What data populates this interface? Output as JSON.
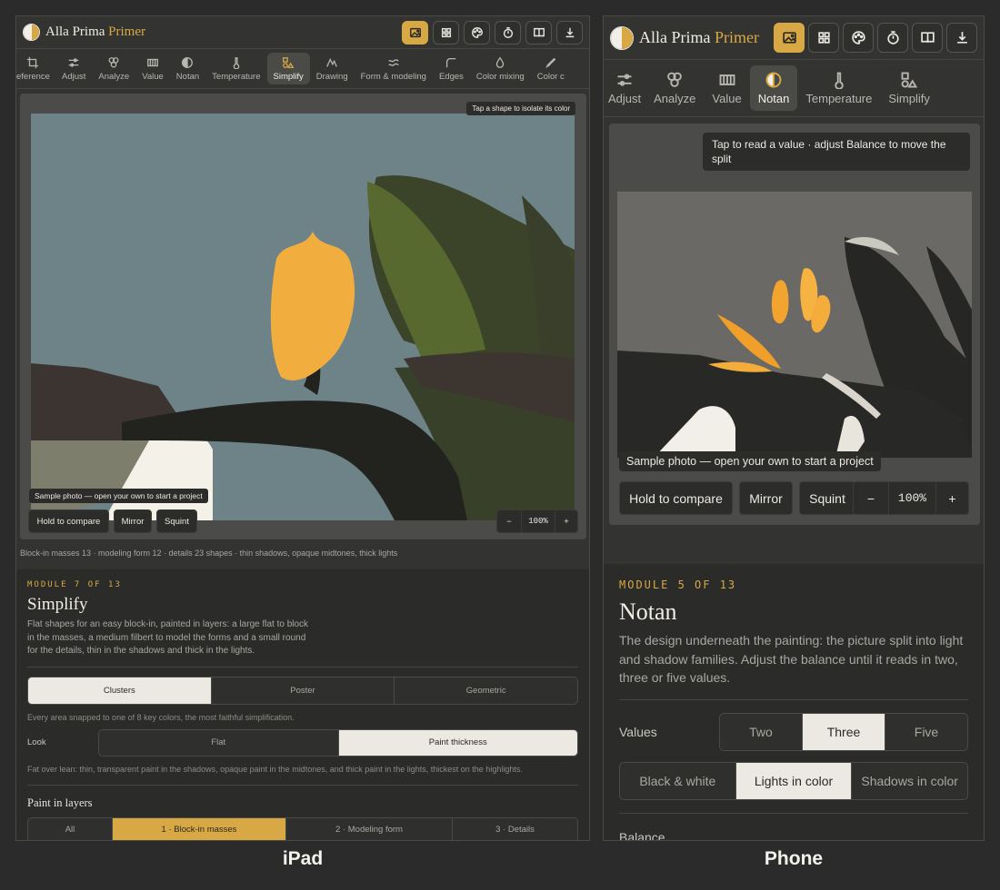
{
  "ipad": {
    "caption": "iPad",
    "brand": "Alla Prima",
    "brand_accent": "Primer",
    "tabs": [
      "eference",
      "Adjust",
      "Analyze",
      "Value",
      "Notan",
      "Temperature",
      "Simplify",
      "Drawing",
      "Form & modeling",
      "Edges",
      "Color mixing",
      "Color c"
    ],
    "active_tab": "Simplify",
    "hint": "Tap a shape to isolate its color",
    "sample": "Sample photo — open your own to start a project",
    "hold": "Hold to compare",
    "mirror": "Mirror",
    "squint": "Squint",
    "zoom_minus": "−",
    "zoom_value": "100%",
    "zoom_plus": "+",
    "stats": "Block-in masses 13 · modeling form 12 · details 23 shapes · thin shadows, opaque midtones, thick lights",
    "module": "MODULE 7 OF 13",
    "title": "Simplify",
    "desc_lines": [
      "Flat shapes for an easy block-in, painted in layers: a large flat to block",
      "in the masses, a medium filbert to model the forms and a small round",
      "for the details, thin in the shadows and thick in the lights."
    ],
    "mode_options": [
      "Clusters",
      "Poster",
      "Geometric"
    ],
    "mode_selected": "Clusters",
    "mode_note": "Every area snapped to one of 8 key colors, the most faithful simplification.",
    "look_label": "Look",
    "look_options": [
      "Flat",
      "Paint thickness"
    ],
    "look_selected": "Paint thickness",
    "look_note": "Fat over lean: thin, transparent paint in the shadows, opaque paint in the midtones, and thick paint in the lights, thickest on the highlights.",
    "layers_title": "Paint in layers",
    "layer_options": [
      "All",
      "1 · Block-in masses",
      "2 · Modeling form",
      "3 · Details"
    ],
    "layer_selected": "1 · Block-in masses"
  },
  "phone": {
    "caption": "Phone",
    "brand": "Alla Prima",
    "brand_accent": "Primer",
    "tabs": [
      "Adjust",
      "Analyze",
      "Value",
      "Notan",
      "Temperature",
      "Simplify"
    ],
    "active_tab": "Notan",
    "hint": "Tap to read a value · adjust Balance to move the split",
    "sample": "Sample photo — open your own to start a project",
    "hold": "Hold to compare",
    "mirror": "Mirror",
    "squint": "Squint",
    "zoom_minus": "−",
    "zoom_value": "100%",
    "zoom_plus": "+",
    "module": "MODULE 5 OF 13",
    "title": "Notan",
    "desc_lines": [
      "The design underneath the painting: the picture split into light",
      "and shadow families. Adjust the balance until it reads in two,",
      "three or five values."
    ],
    "values_label": "Values",
    "value_options": [
      "Two",
      "Three",
      "Five"
    ],
    "value_selected": "Three",
    "color_options": [
      "Black & white",
      "Lights in color",
      "Shadows in color"
    ],
    "color_selected": "Lights in color",
    "balance_label": "Balance"
  },
  "colors": {
    "accent": "#d8a844",
    "surface": "#333331",
    "panel": "#2b2b29",
    "selected": "#ece9e3"
  },
  "icons": {
    "toolbar": [
      "image-icon",
      "grid-icon",
      "palette-icon",
      "timer-icon",
      "book-icon",
      "download-icon"
    ],
    "tabs": [
      "crop-icon",
      "sliders-icon",
      "circles-icon",
      "value-scale-icon",
      "half-circle-icon",
      "thermometer-icon",
      "shapes-icon",
      "drawing-icon",
      "wave-icon",
      "edge-icon",
      "drop-icon",
      "pen-icon"
    ]
  }
}
